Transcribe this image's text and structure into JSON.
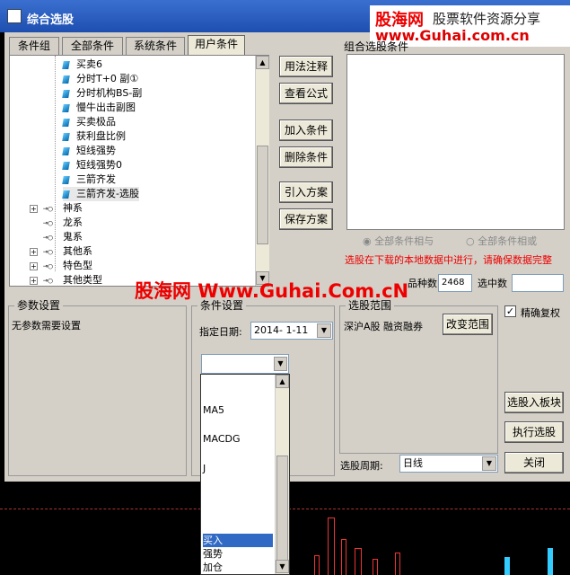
{
  "window": {
    "title": "综合选股"
  },
  "watermark_top": {
    "line1": "股海网",
    "line1b": "股票软件资源分享",
    "line2": "www.Guhai.com.cn"
  },
  "tabs": [
    "条件组",
    "全部条件",
    "系统条件",
    "用户条件"
  ],
  "tree": {
    "leaf_items": [
      "买卖6",
      "分时T+0 副①",
      "分时机构BS-副",
      "慢牛出击副图",
      "买卖极品",
      "获利盘比例",
      "短线强势",
      "短线强势0",
      "三箭齐发",
      "三箭齐发-选股"
    ],
    "groups": [
      {
        "label": "神系",
        "expander": "+"
      },
      {
        "label": "龙系",
        "expander": ""
      },
      {
        "label": "鬼系",
        "expander": ""
      },
      {
        "label": "其他系",
        "expander": "+"
      },
      {
        "label": "特色型",
        "expander": "+"
      },
      {
        "label": "其他类型",
        "expander": "+"
      }
    ]
  },
  "buttons": {
    "usage_notes": "用法注释",
    "view_formula": "查看公式",
    "add_condition": "加入条件",
    "delete_condition": "删除条件",
    "import_scheme": "引入方案",
    "save_scheme": "保存方案",
    "change_range": "改变范围",
    "select_to_block": "选股入板块",
    "execute": "执行选股",
    "close": "关闭"
  },
  "combo": {
    "label": "组合选股条件"
  },
  "radios": {
    "all_and": "全部条件相与",
    "all_or": "全部条件相或"
  },
  "warning": "选股在下载的本地数据中进行，请确保数据完整",
  "watermark_mid": "股海网 Www.Guhai.Com.cN",
  "counts": {
    "total_label": "品种数",
    "total_value": "2468",
    "selected_label": "选中数",
    "selected_value": ""
  },
  "params": {
    "title": "参数设置",
    "text": "无参数需要设置"
  },
  "condition_settings": {
    "title": "条件设置",
    "date_label": "指定日期:",
    "date_value": "2014- 1-11"
  },
  "stock_range": {
    "title": "选股范围",
    "text": "深沪A股 融资融券"
  },
  "precise": {
    "label": "精确复权",
    "checked": true
  },
  "period": {
    "label": "选股周期:",
    "value": "日线"
  },
  "dropdown_list": [
    "MA5",
    "MACDG",
    "J",
    "买入",
    "强势",
    "加仓"
  ],
  "dropdown_selected": "买入"
}
